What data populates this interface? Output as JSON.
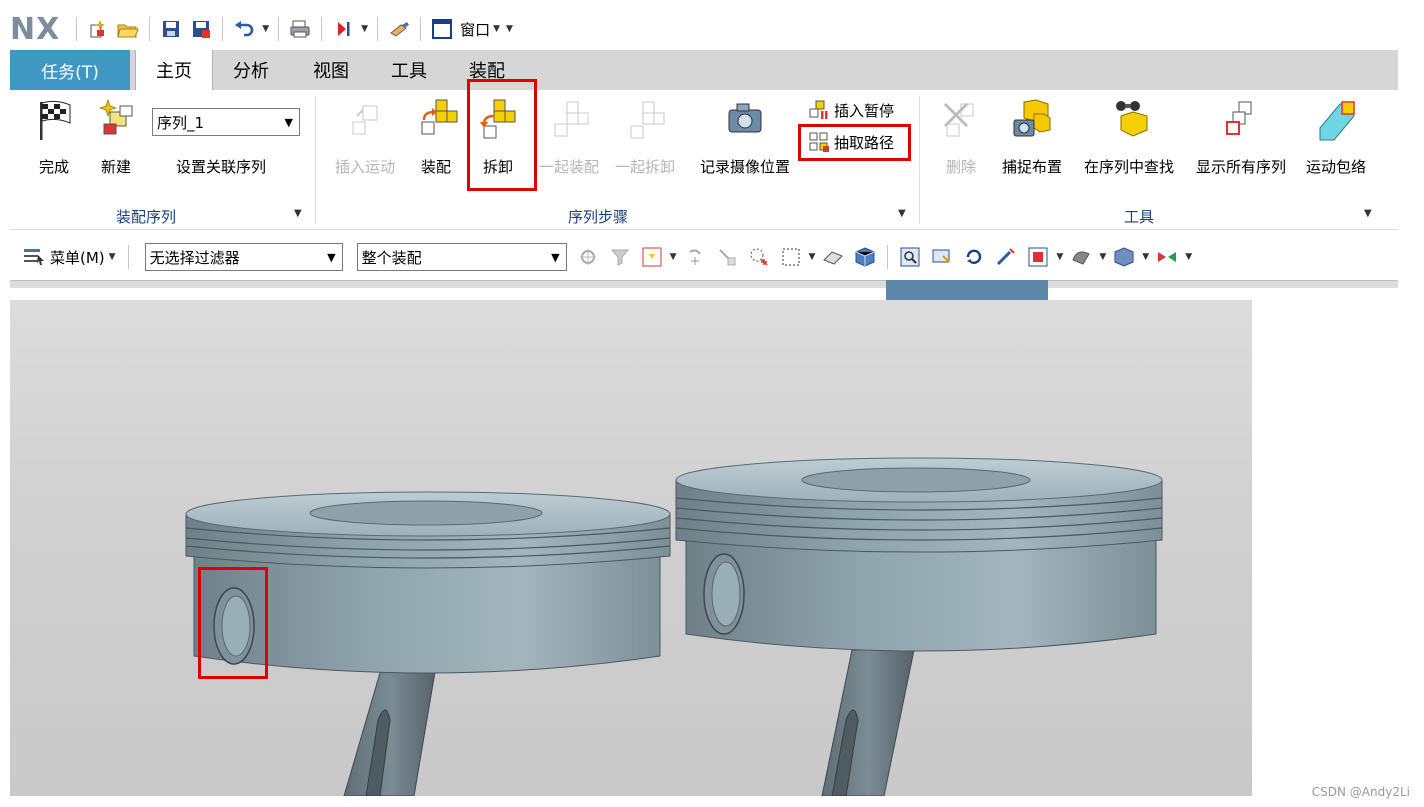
{
  "app": {
    "logo": "NX"
  },
  "quick_access": {
    "window_label": "窗口"
  },
  "tabs": {
    "task": "任务(T)",
    "items": [
      "主页",
      "分析",
      "视图",
      "工具",
      "装配"
    ],
    "active_index": 0
  },
  "ribbon": {
    "group1": {
      "label": "装配序列",
      "done": "完成",
      "new": "新建",
      "sequence_select": "序列_1",
      "set_assoc": "设置关联序列"
    },
    "group2": {
      "label": "序列步骤",
      "insert_motion": "插入运动",
      "assemble": "装配",
      "disassemble": "拆卸",
      "assemble_together": "一起装配",
      "disassemble_together": "一起拆卸",
      "record_camera": "记录摄像位置",
      "insert_pause": "插入暂停",
      "extract_path": "抽取路径"
    },
    "group3": {
      "label": "工具",
      "delete": "删除",
      "capture_layout": "捕捉布置",
      "find_in_sequence": "在序列中查找",
      "show_all": "显示所有序列",
      "motion_envelope": "运动包络"
    }
  },
  "toolbar": {
    "menu": "菜单(M)",
    "filter": "无选择过滤器",
    "scope": "整个装配"
  },
  "watermark": "CSDN @Andy2Li",
  "colors": {
    "task_tab": "#3f98c3",
    "highlight": "#e00000",
    "group_label": "#1b3f7f",
    "part": "#8fa3ad"
  }
}
